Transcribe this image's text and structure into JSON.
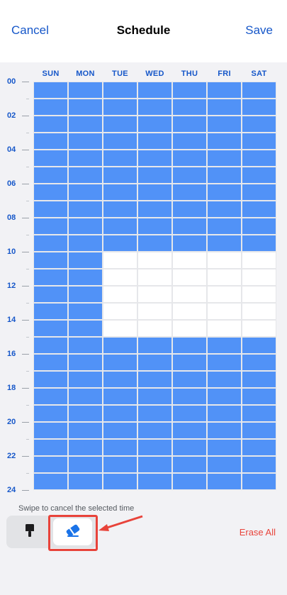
{
  "header": {
    "cancel_label": "Cancel",
    "title": "Schedule",
    "save_label": "Save"
  },
  "schedule": {
    "days": [
      "SUN",
      "MON",
      "TUE",
      "WED",
      "THU",
      "FRI",
      "SAT"
    ],
    "hour_labels": [
      "00",
      "02",
      "04",
      "06",
      "08",
      "10",
      "12",
      "14",
      "16",
      "18",
      "20",
      "22",
      "24"
    ],
    "slots_per_day": 24,
    "selected_color": "#5192f7",
    "unselected_color": "#ffffff",
    "selection": {
      "SUN": "all",
      "MON": "all",
      "TUE": "all_except_10_to_15",
      "WED": "all_except_10_to_15",
      "THU": "all_except_10_to_15",
      "FRI": "all_except_10_to_15",
      "SAT": "all_except_10_to_15"
    }
  },
  "toolbar": {
    "hint": "Swipe to cancel the selected time",
    "brush_icon": "paint-brush-icon",
    "eraser_icon": "eraser-icon",
    "active_tool": "eraser",
    "erase_all_label": "Erase All",
    "accent_color": "#1657c9",
    "danger_color": "#e8433a"
  }
}
